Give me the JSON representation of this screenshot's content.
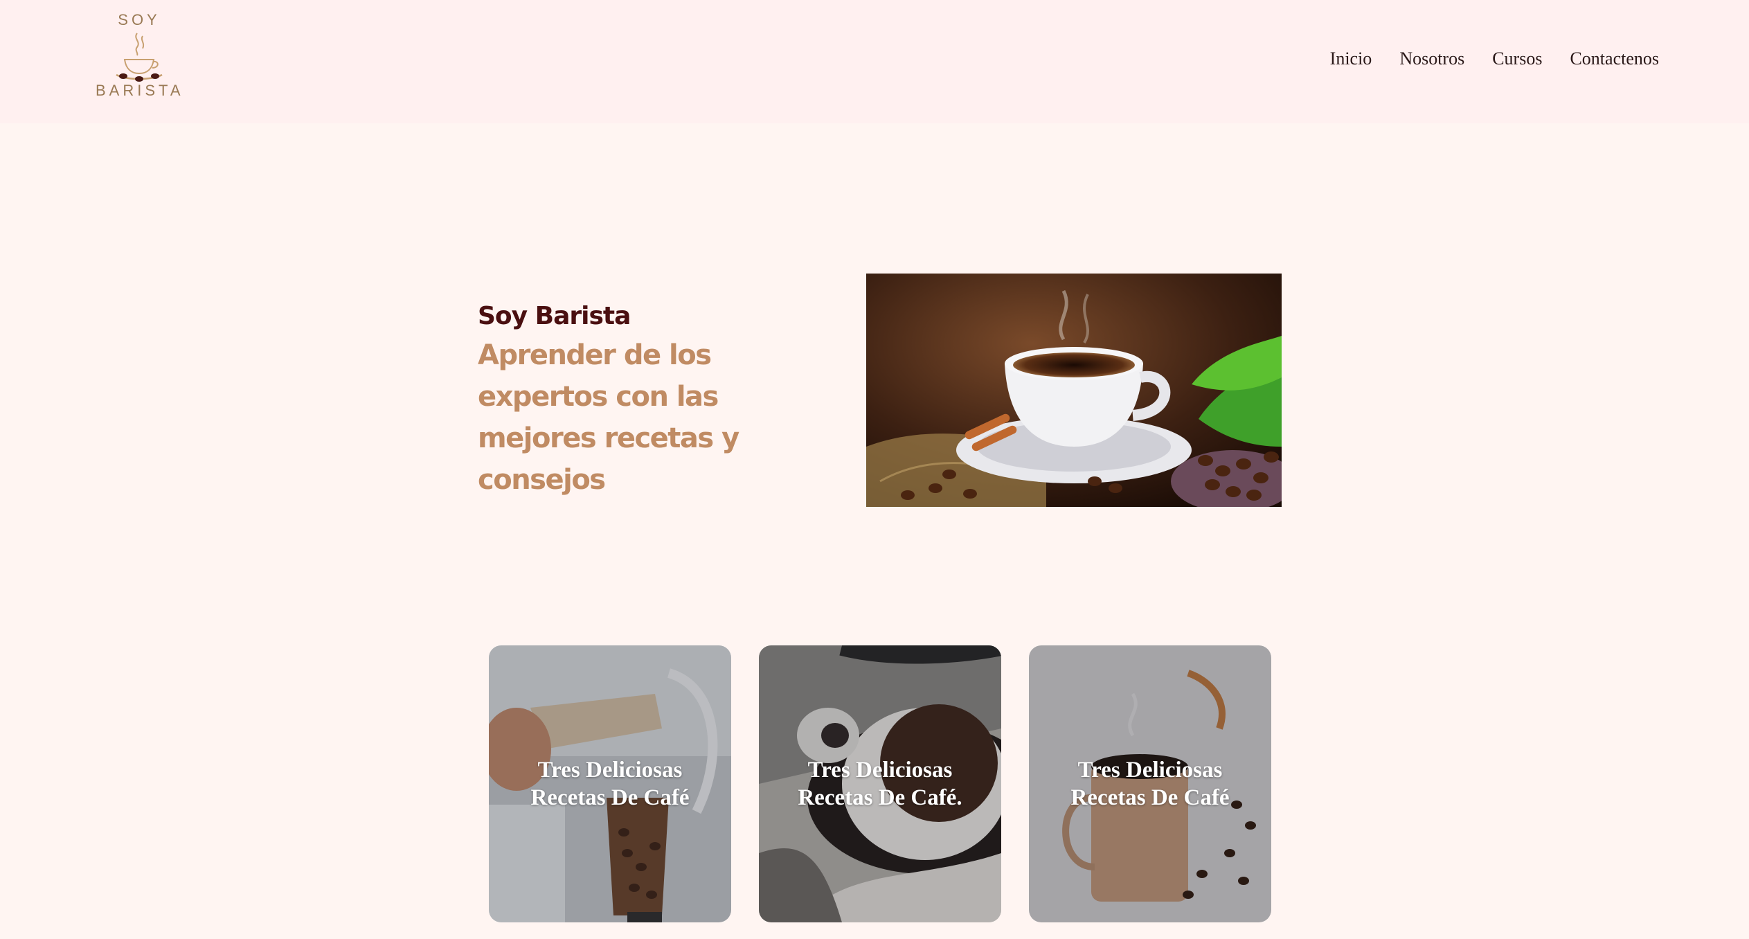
{
  "logo": {
    "top_text": "SOY",
    "bottom_text": "BARISTA"
  },
  "nav": {
    "items": [
      "Inicio",
      "Nosotros",
      "Cursos",
      "Contactenos"
    ]
  },
  "hero": {
    "kicker": "Soy Barista",
    "heading": "Aprender de los expertos con las mejores recetas y consejos"
  },
  "cards": [
    {
      "title": "Tres Deliciosas Recetas De Café"
    },
    {
      "title": "Tres Deliciosas Recetas De Café."
    },
    {
      "title": "Tres Deliciosas Recetas De Café"
    }
  ],
  "colors": {
    "page_bg": "#fff5f2",
    "header_bg": "#fff0f0",
    "kicker": "#4a0f10",
    "heading": "#c08b63"
  }
}
